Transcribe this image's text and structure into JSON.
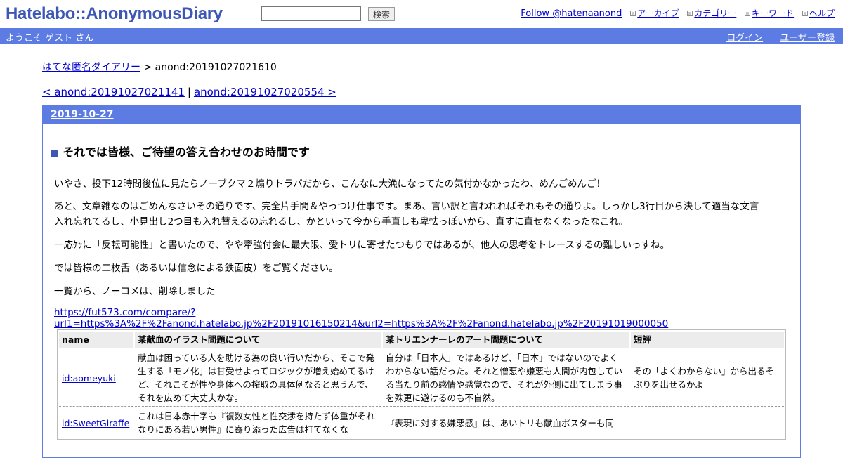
{
  "header": {
    "logo": "Hatelabo::AnonymousDiary",
    "search_button": "検索",
    "follow": "Follow @hatenaanond",
    "nav": [
      "アーカイブ",
      "カテゴリー",
      "キーワード",
      "ヘルプ"
    ]
  },
  "bar": {
    "welcome": "ようこそ ゲスト さん",
    "login": "ログイン",
    "register": "ユーザー登録"
  },
  "breadcrumb": {
    "home": "はてな匿名ダイアリー",
    "current": " > anond:20191027021610"
  },
  "pager": {
    "prev": "< anond:20191027021141",
    "sep": "|",
    "next": "anond:20191027020554 >"
  },
  "day": {
    "date": "2019-10-27",
    "title_bullet": "■",
    "title": "それでは皆様、ご待望の答え合わせのお時間です",
    "p1": "いやさ、投下12時間後位に見たらノーブクマ２煽りトラバだから、こんなに大漁になってたの気付かなかったわ、めんごめんご！",
    "p2a": "あと、文章雑なのはごめんなさいその通りです、完全片手間＆やっつけ仕事です。まあ、言い訳と言われればそれもその通りよ。しっかし3行目から決して適当な文言",
    "p2b": "入れ忘れてるし、小見出し2つ目も入れ替えるの忘れるし、かといって今から手直しも卑怯っぽいから、直すに直せなくなったなこれ。",
    "p3": "一応ｹｯに「反転可能性」と書いたので、やや牽強付会に最大限、愛トリに寄せたつもりではあるが、他人の思考をトレースするの難しいっすね。",
    "p4": "では皆様の二枚舌（あるいは信念による鉄面皮）をご覧ください。",
    "p5": "一覧から、ノーコメは、削除しました",
    "url": "https://fut573.com/compare/?url1=https%3A%2F%2Fanond.hatelabo.jp%2F20191016150214&url2=https%3A%2F%2Fanond.hatelabo.jp%2F20191019000050"
  },
  "table": {
    "headers": [
      "name",
      "某献血のイラスト問題について",
      "某トリエンナーレのアート問題について",
      "短評"
    ],
    "rows": [
      {
        "name": "id:aomeyuki",
        "c1": "献血は困っている人を助ける為の良い行いだから、そこで発生する「モノ化」は甘受せよってロジックが増え始めてるけど、それこそが性や身体への搾取の具体例なると思うんで、それを広めて大丈夫かな。",
        "c2": "自分は「日本人」ではあるけど、「日本」ではないのでよくわからない話だった。それと憎悪や嫌悪も人間が内包している当たり前の感情や感覚なので、それが外側に出てしまう事を殊更に避けるのも不自然。",
        "c3": "その「よくわからない」から出るそぶりを出せるかよ"
      },
      {
        "name": "id:SweetGiraffe",
        "c1": "これは日本赤十字も『複数女性と性交渉を持たず体重がそれなりにある若い男性』に寄り添った広告は打てなくな",
        "c2": "『表現に対する嫌悪感』は、あいトリも献血ポスターも同",
        "c3": ""
      }
    ]
  }
}
